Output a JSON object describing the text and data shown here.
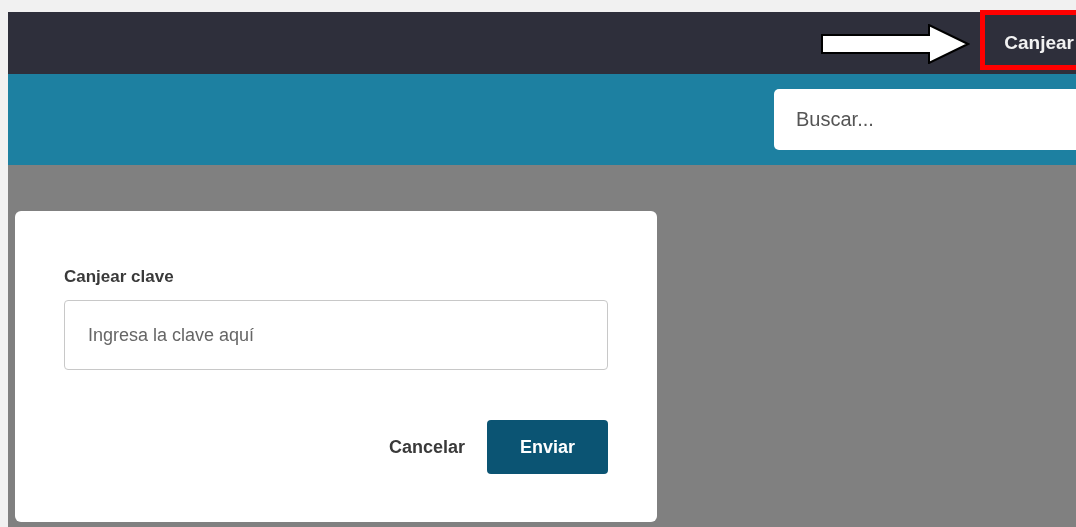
{
  "top_bar": {
    "redeem_link": "Canjear"
  },
  "search": {
    "placeholder": "Buscar..."
  },
  "dialog": {
    "label": "Canjear clave",
    "field": {
      "placeholder": "Ingresa la clave aquí"
    },
    "buttons": [
      {
        "kind": "text",
        "label": "Cancelar"
      },
      {
        "kind": "primary",
        "label": "Enviar"
      }
    ]
  }
}
